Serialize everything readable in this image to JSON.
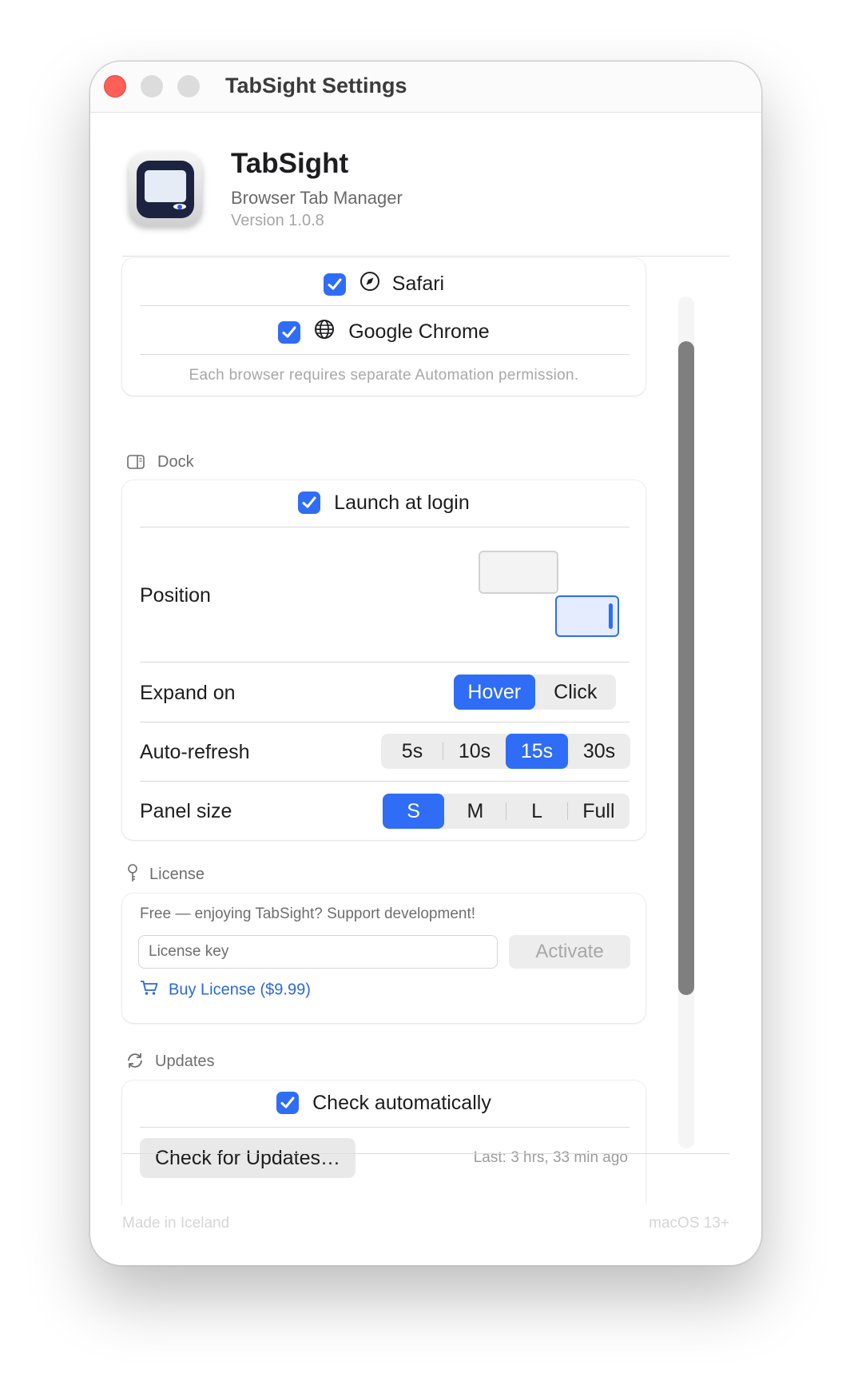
{
  "window": {
    "title": "TabSight Settings"
  },
  "app": {
    "name": "TabSight",
    "subtitle": "Browser Tab Manager",
    "version": "Version 1.0.8"
  },
  "browsers": {
    "items": [
      {
        "label": "Safari",
        "checked": true,
        "icon": "compass-icon"
      },
      {
        "label": "Google Chrome",
        "checked": true,
        "icon": "globe-icon"
      }
    ],
    "hint": "Each browser requires separate Automation permission."
  },
  "dock": {
    "section_label": "Dock",
    "launch_at_login": {
      "label": "Launch at login",
      "checked": true
    },
    "position": {
      "label": "Position",
      "selected": "right"
    },
    "expand_on": {
      "label": "Expand on",
      "options": [
        "Hover",
        "Click"
      ],
      "selected": "Hover"
    },
    "auto_refresh": {
      "label": "Auto-refresh",
      "options": [
        "5s",
        "10s",
        "15s",
        "30s"
      ],
      "selected": "15s"
    },
    "panel_size": {
      "label": "Panel size",
      "options": [
        "S",
        "M",
        "L",
        "Full"
      ],
      "selected": "S"
    }
  },
  "license": {
    "section_label": "License",
    "status": "Free — enjoying TabSight? Support development!",
    "key_placeholder": "License key",
    "activate_label": "Activate",
    "buy_label": "Buy License ($9.99)"
  },
  "updates": {
    "section_label": "Updates",
    "check_automatically": {
      "label": "Check automatically",
      "checked": true
    },
    "check_button": "Check for Updates…",
    "last_checked": "Last: 3 hrs, 33 min ago"
  },
  "footer": {
    "left": "Made in Iceland",
    "right": "macOS 13+"
  },
  "colors": {
    "accent": "#2f6df6",
    "link": "#2a67e0",
    "close": "#ff5f57"
  }
}
